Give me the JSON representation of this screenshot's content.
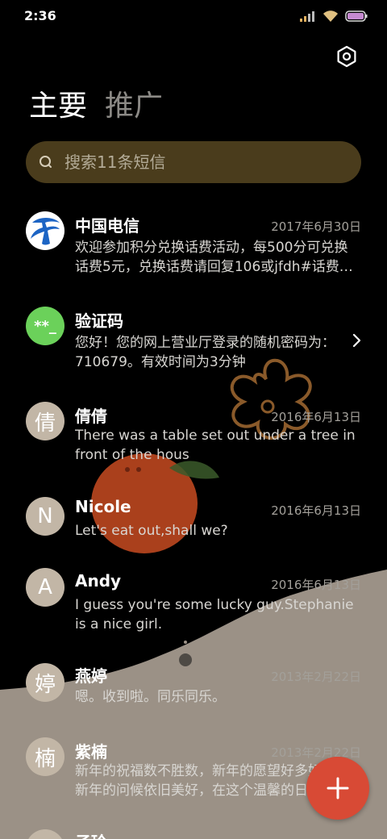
{
  "status_bar": {
    "time": "2:36"
  },
  "tabs": [
    {
      "label": "主要"
    },
    {
      "label": "推广"
    }
  ],
  "search": {
    "placeholder": "搜索11条短信"
  },
  "conversations": [
    {
      "name": "中国电信",
      "date": "2017年6月30日",
      "preview": "欢迎参加积分兑换话费活动，每500分可兑换话费5元，兑换话费请回复106或jfdh#话费…",
      "avatar_icon": "china-telecom-logo-icon"
    },
    {
      "name": "验证码",
      "date": "",
      "preview": "您好！您的网上营业厅登录的随机密码为：710679。有效时间为3分钟",
      "avatar_text": "**_"
    },
    {
      "name": "倩倩",
      "date": "2016年6月13日",
      "preview": "There was a table set out under a tree in front of the hous",
      "avatar_text": "倩"
    },
    {
      "name": "Nicole",
      "date": "2016年6月13日",
      "preview": "Let's eat out,shall we?",
      "avatar_text": "N"
    },
    {
      "name": "Andy",
      "date": "2016年6月13日",
      "preview": "I guess you're some lucky guy.Stephanie is a nice girl.",
      "avatar_text": "A"
    },
    {
      "name": "燕婷",
      "date": "2013年2月22日",
      "preview": "嗯。收到啦。同乐同乐。",
      "avatar_text": "婷"
    },
    {
      "name": "紫楠",
      "date": "2013年2月22日",
      "preview": "新年的祝福数不胜数，新年的愿望好多好多，新年的问候依旧美好，在这个温馨的日子里",
      "avatar_text": "楠"
    },
    {
      "name": "子玲",
      "date": "",
      "preview": "",
      "avatar_text": "玲"
    }
  ],
  "colors": {
    "background": "#000000",
    "wallpaper_wave": "#9b9186",
    "search_bg": "#4a3c1c",
    "fab": "#d84a35",
    "verify_avatar": "#6bd15a",
    "telecom_blue": "#1c64c4"
  },
  "icons": {
    "settings": "settings-icon",
    "search": "search-icon",
    "fab": "plus-icon",
    "chevron": "chevron-right-icon"
  }
}
